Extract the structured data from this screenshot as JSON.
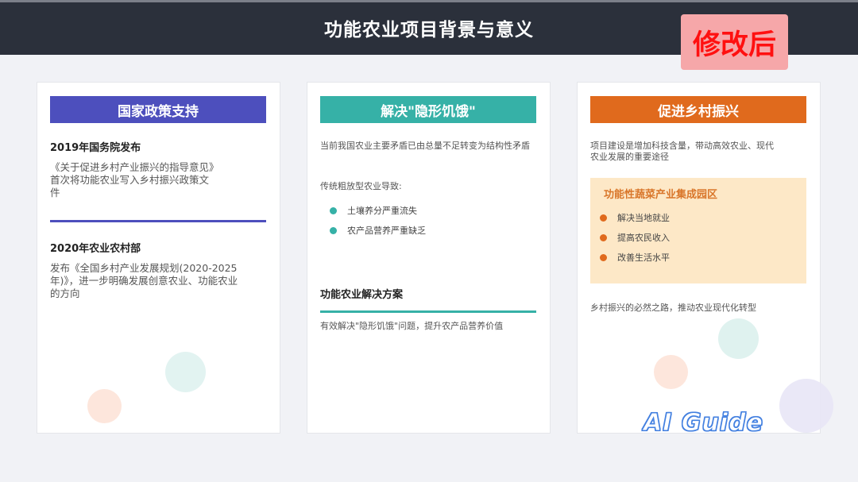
{
  "header": {
    "title": "功能农业项目背景与意义"
  },
  "badge": {
    "label": "修改后"
  },
  "colors": {
    "header_bg": "#2b303b",
    "policy": "#4d4fbd",
    "hunger": "#36b1a7",
    "revival": "#e06a1d",
    "badge_bg": "#f6a7a9",
    "badge_text": "#ff1010"
  },
  "cards": {
    "policy": {
      "heading": "国家政策支持",
      "item1_title": "2019年国务院发布",
      "item1_line1": "《关于促进乡村产业振兴的指导意见》",
      "item1_line2": "首次将功能农业写入乡村振兴政策文",
      "item1_line3": "件",
      "item2_title": "2020年农业农村部",
      "item2_line1": "发布《全国乡村产业发展规划(2020-2025",
      "item2_line2": "年)》，进一步明确发展创意农业、功能农业",
      "item2_line3": "的方向"
    },
    "hunger": {
      "heading": "解决\"隐形饥饿\"",
      "intro": "当前我国农业主要矛盾已由总量不足转变为结构性矛盾",
      "cause_label": "传统粗放型农业导致:",
      "bullets": [
        "土壤养分严重流失",
        "农产品营养严重缺乏"
      ],
      "solution_title": "功能农业解决方案",
      "solution_text": "有效解决\"隐形饥饿\"问题，提升农产品营养价值"
    },
    "revival": {
      "heading": "促进乡村振兴",
      "intro_line1": "项目建设是增加科技含量，带动高效农业、现代",
      "intro_line2": "农业发展的重要途径",
      "box_title": "功能性蔬菜产业集成园区",
      "bullets": [
        "解决当地就业",
        "提高农民收入",
        "改善生活水平"
      ],
      "footer": "乡村振兴的必然之路，推动农业现代化转型"
    }
  },
  "watermark": {
    "text": "AI Guide"
  }
}
